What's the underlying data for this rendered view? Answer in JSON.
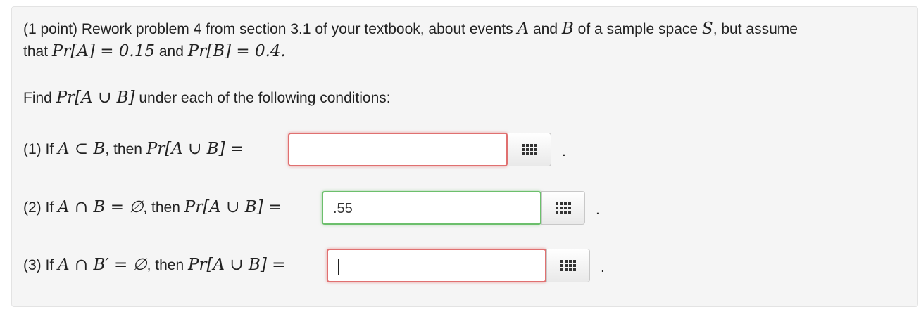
{
  "problem": {
    "intro_prefix": "(1 point) Rework problem 4 from section 3.1 of your textbook, about events",
    "event_a": "A",
    "and": "and",
    "event_b": "B",
    "of_space": "of a sample space",
    "space": "S",
    "but_assume": ", but assume",
    "that": "that",
    "pr_a": "Pr[A] = 0.15",
    "and2": "and",
    "pr_b": "Pr[B] = 0.4.",
    "find_prefix": "Find",
    "find_expr": "Pr[A ∪ B]",
    "find_suffix": "under each of the following conditions:"
  },
  "parts": [
    {
      "label": "(1) If",
      "condition": "A ⊂ B",
      "then": ", then",
      "expr": "Pr[A ∪ B] =",
      "answer": "",
      "status": "incorrect"
    },
    {
      "label": "(2) If",
      "condition": "A ∩ B = ∅",
      "then": ", then",
      "expr": "Pr[A ∪ B] =",
      "answer": ".55",
      "status": "correct"
    },
    {
      "label": "(3) If",
      "condition": "A ∩ B′ = ∅",
      "then": ", then",
      "expr": "Pr[A ∪ B] =",
      "answer": "",
      "status": "incorrect"
    }
  ],
  "period": ".",
  "icons": {
    "palette": "equation-palette-icon"
  }
}
